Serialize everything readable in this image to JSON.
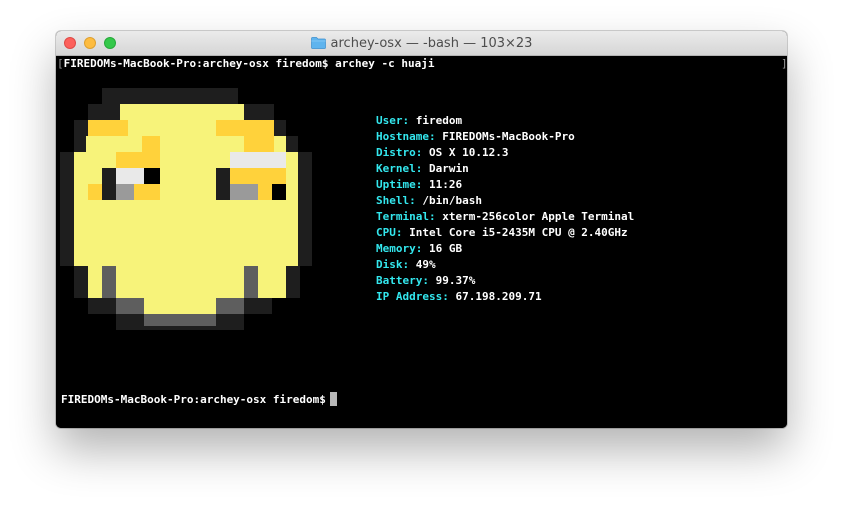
{
  "window": {
    "title": "archey-osx — -bash — 103×23",
    "folder_icon": "folder-icon"
  },
  "terminal": {
    "command_line": {
      "prompt": "FIREDOMs-MacBook-Pro:archey-osx firedom$",
      "command": "archey -c huaji"
    },
    "info": [
      {
        "key": "User:",
        "value": "firedom"
      },
      {
        "key": "Hostname:",
        "value": "FIREDOMs-MacBook-Pro"
      },
      {
        "key": "Distro:",
        "value": "OS X 10.12.3"
      },
      {
        "key": "Kernel:",
        "value": "Darwin"
      },
      {
        "key": "Uptime:",
        "value": "11:26"
      },
      {
        "key": "Shell:",
        "value": "/bin/bash"
      },
      {
        "key": "Terminal:",
        "value": "xterm-256color Apple Terminal"
      },
      {
        "key": "CPU:",
        "value": "Intel Core i5-2435M CPU @ 2.40GHz"
      },
      {
        "key": "Memory:",
        "value": "16 GB"
      },
      {
        "key": "Disk:",
        "value": "49%"
      },
      {
        "key": "Battery:",
        "value": "99.37%"
      },
      {
        "key": "IP Address:",
        "value": "67.198.209.71"
      }
    ],
    "final_prompt": "FIREDOMs-MacBook-Pro:archey-osx firedom$"
  },
  "colors": {
    "key_color": "#33e7ee",
    "face_yellow": "#f7f37a",
    "face_gold": "#ffd23b",
    "face_outline": "#1e1e1e",
    "face_gray": "#5e5e5e",
    "eye_white": "#e9e9e9"
  }
}
